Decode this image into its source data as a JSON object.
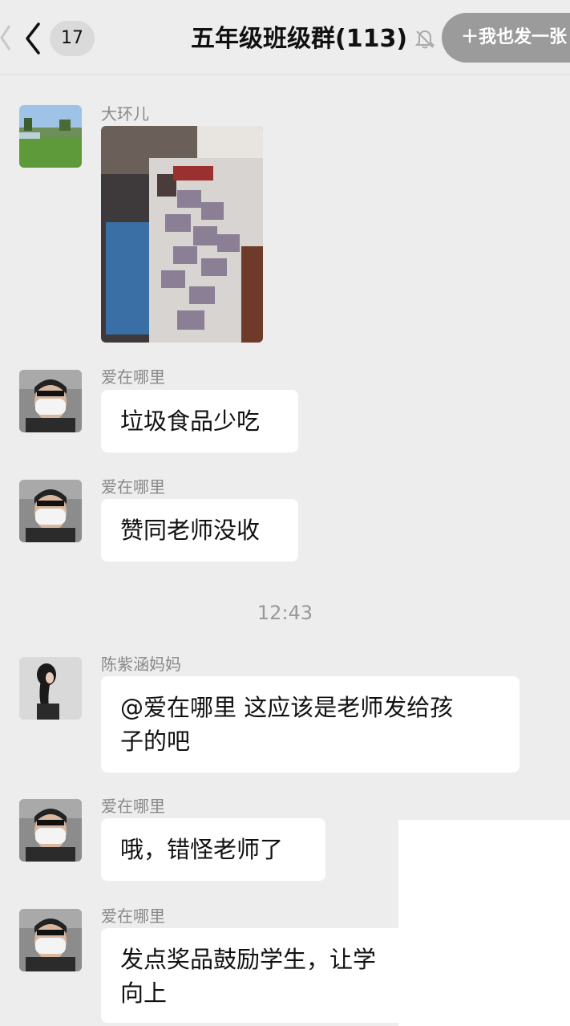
{
  "header": {
    "back_label": "",
    "unread_count": "17",
    "group_title": "五年级班级群(113)",
    "share_label": "＋我也发一张"
  },
  "messages": [
    {
      "sender": "大环儿",
      "type": "image",
      "text": ""
    },
    {
      "sender": "爱在哪里",
      "type": "text",
      "text": "垃圾食品少吃"
    },
    {
      "sender": "爱在哪里",
      "type": "text",
      "text": "赞同老师没收"
    },
    {
      "sender": "陈紫涵妈妈",
      "type": "text",
      "line1": "@爱在哪里 这应该是老师发给孩",
      "line2": "子的吧"
    },
    {
      "sender": "爱在哪里",
      "type": "text",
      "text": "哦，错怪老师了"
    },
    {
      "sender": "爱在哪里",
      "type": "text",
      "line1": "发点奖品鼓励学生，让学",
      "line2": "向上"
    }
  ],
  "time_separator": "12:43",
  "colors": {
    "background": "#ededed",
    "bubble": "#ffffff",
    "sender_text": "#888888",
    "share_pill": "#9b9b9b"
  },
  "icons": {
    "back": "chevron-left-icon",
    "mute": "bell-off-icon"
  }
}
